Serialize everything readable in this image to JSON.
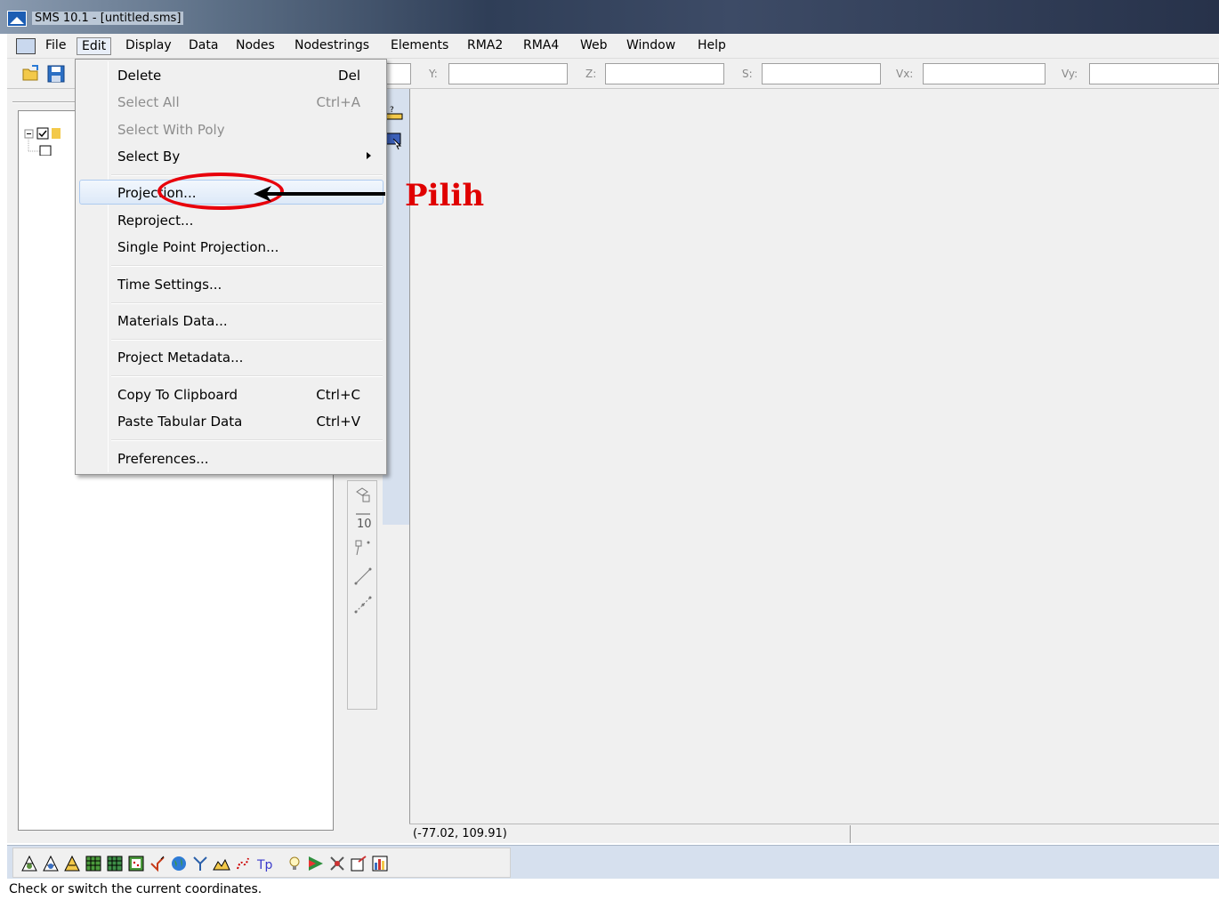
{
  "window": {
    "title": "SMS 10.1 - [untitled.sms]"
  },
  "menubar": {
    "items": [
      "File",
      "Edit",
      "Display",
      "Data",
      "Nodes",
      "Nodestrings",
      "Elements",
      "RMA2",
      "RMA4",
      "Web",
      "Window",
      "Help"
    ],
    "active": "Edit"
  },
  "toolbar": {
    "coords": [
      {
        "label": "Y:"
      },
      {
        "label": "Z:"
      },
      {
        "label": "S:"
      },
      {
        "label": "Vx:"
      },
      {
        "label": "Vy:"
      }
    ]
  },
  "edit_menu": {
    "items": [
      {
        "label": "Delete",
        "shortcut": "Del",
        "enabled": true
      },
      {
        "label": "Select All",
        "shortcut": "Ctrl+A",
        "enabled": false
      },
      {
        "label": "Select With Poly",
        "shortcut": "",
        "enabled": false
      },
      {
        "label": "Select By",
        "shortcut": "",
        "enabled": true,
        "submenu": true
      },
      {
        "label": "Projection...",
        "shortcut": "",
        "enabled": true,
        "highlighted": true
      },
      {
        "label": "Reproject...",
        "shortcut": "",
        "enabled": true
      },
      {
        "label": "Single Point Projection...",
        "shortcut": "",
        "enabled": true
      },
      {
        "label": "Time Settings...",
        "shortcut": "",
        "enabled": true
      },
      {
        "label": "Materials Data...",
        "shortcut": "",
        "enabled": true
      },
      {
        "label": "Project Metadata...",
        "shortcut": "",
        "enabled": true
      },
      {
        "label": "Copy To Clipboard",
        "shortcut": "Ctrl+C",
        "enabled": true
      },
      {
        "label": "Paste Tabular Data",
        "shortcut": "Ctrl+V",
        "enabled": true
      },
      {
        "label": "Preferences...",
        "shortcut": "",
        "enabled": true
      }
    ]
  },
  "annotation": {
    "label": "Pilih",
    "color": "#e00000"
  },
  "coord_readout": "(-77.02, 109.91)",
  "statusbar": {
    "text": "Check or switch the current coordinates."
  },
  "colors": {
    "menu_bg": "#f0f0f0",
    "highlight_border": "#aecbf0",
    "panel_blue": "#d6e0ee"
  }
}
